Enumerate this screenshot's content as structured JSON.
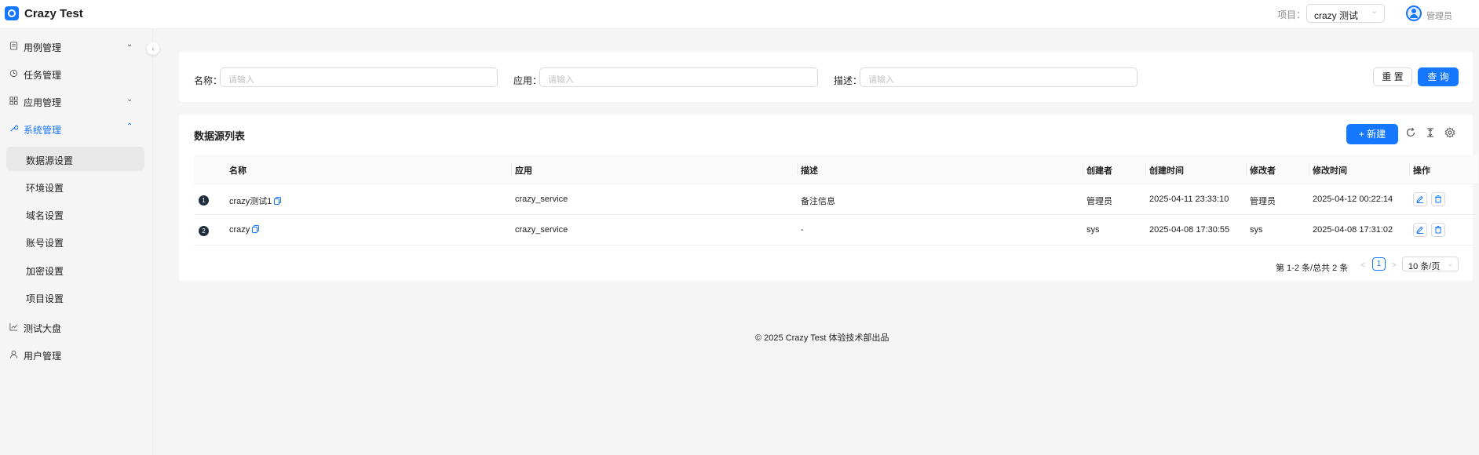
{
  "header": {
    "app_title": "Crazy Test",
    "project_label": "项目：",
    "project_value": "crazy 测试",
    "user_name": "管理员"
  },
  "sidebar": {
    "menu": [
      {
        "label": "用例管理",
        "icon": "file-icon",
        "expandable": true
      },
      {
        "label": "任务管理",
        "icon": "clock-icon",
        "expandable": false
      },
      {
        "label": "应用管理",
        "icon": "apps-grid-icon",
        "expandable": true
      },
      {
        "label": "系统管理",
        "icon": "wrench-icon",
        "expandable": true,
        "active": true
      },
      {
        "label": "测试大盘",
        "icon": "chart-icon",
        "expandable": false
      },
      {
        "label": "用户管理",
        "icon": "user-icon",
        "expandable": false
      }
    ],
    "submenu": [
      {
        "label": "数据源设置",
        "selected": true
      },
      {
        "label": "环境设置"
      },
      {
        "label": "域名设置"
      },
      {
        "label": "账号设置"
      },
      {
        "label": "加密设置"
      },
      {
        "label": "项目设置"
      }
    ]
  },
  "filters": {
    "name_label": "名称：",
    "name_placeholder": "请输入",
    "app_label": "应用：",
    "app_placeholder": "请输入",
    "desc_label": "描述：",
    "desc_placeholder": "请输入",
    "reset_label": "重 置",
    "query_label": "查 询"
  },
  "list": {
    "title": "数据源列表",
    "new_label": "新建",
    "columns": [
      "名称",
      "应用",
      "描述",
      "创建者",
      "创建时间",
      "修改者",
      "修改时间",
      "操作"
    ],
    "rows": [
      {
        "index": "1",
        "name": "crazy测试1",
        "app": "crazy_service",
        "desc": "备注信息",
        "creator": "管理员",
        "created": "2025-04-11 23:33:10",
        "modifier": "管理员",
        "modified": "2025-04-12 00:22:14"
      },
      {
        "index": "2",
        "name": "crazy",
        "app": "crazy_service",
        "desc": "-",
        "creator": "sys",
        "created": "2025-04-08 17:30:55",
        "modifier": "sys",
        "modified": "2025-04-08 17:31:02"
      }
    ]
  },
  "pagination": {
    "summary": "第 1-2 条/总共 2 条",
    "prev": "<",
    "page": "1",
    "next": ">",
    "page_size": "10 条/页"
  },
  "footer": {
    "text": "© 2025 Crazy Test 体验技术部出品"
  },
  "colors": {
    "primary": "#1677ff",
    "background": "#f5f5f5"
  }
}
